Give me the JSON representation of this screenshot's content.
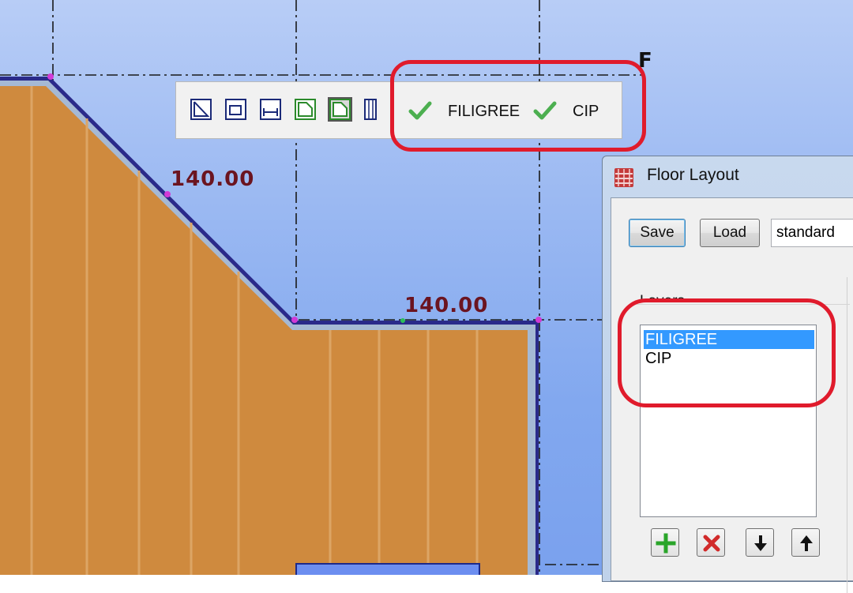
{
  "drawing": {
    "dimension_top": "140.00",
    "dimension_right": "140.00",
    "grid_axis_label": "F"
  },
  "toolbar": {
    "icons": [
      "region-draw-icon",
      "region-rectangle-icon",
      "edge-dimension-icon",
      "outline-icon",
      "outline-selected-icon",
      "columns-icon"
    ],
    "layers": [
      {
        "name": "FILIGREE",
        "visible": true
      },
      {
        "name": "CIP",
        "visible": true
      }
    ]
  },
  "floor_layout": {
    "title": "Floor Layout",
    "save_label": "Save",
    "load_label": "Load",
    "config_value": "standard",
    "layers_caption": "Layers",
    "layers": [
      {
        "name": "FILIGREE",
        "selected": true
      },
      {
        "name": "CIP",
        "selected": false
      }
    ],
    "add_icon": "plus-icon",
    "delete_icon": "delete-icon",
    "down_icon": "arrow-down-icon",
    "up_icon": "arrow-up-icon"
  },
  "colors": {
    "slab_fill": "#cf8a3e",
    "highlight": "#e01b2c",
    "dimension_text": "#6b1420",
    "selection": "#3399ff"
  }
}
